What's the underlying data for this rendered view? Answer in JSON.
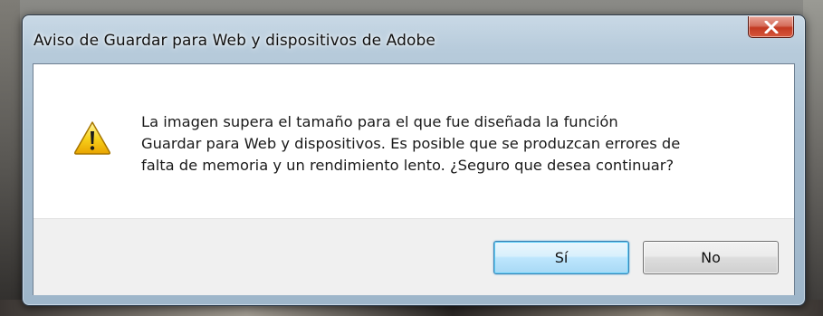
{
  "window": {
    "title": "Aviso de Guardar para Web y dispositivos de Adobe"
  },
  "titlebar_controls": {
    "close_icon": "close-icon"
  },
  "dialog": {
    "icon": "warning-icon",
    "message_lines": [
      "La imagen supera el tamaño para el que fue diseñada la función",
      "Guardar para Web y dispositivos. Es posible que se produzcan errores de",
      "falta de memoria y un rendimiento lento. ¿Seguro que desea continuar?"
    ]
  },
  "buttons": {
    "yes_label": "Sí",
    "no_label": "No"
  },
  "colors": {
    "close_button": "#c23a22",
    "default_button_border": "#3c7fb1",
    "warning_yellow": "#f5c400"
  }
}
